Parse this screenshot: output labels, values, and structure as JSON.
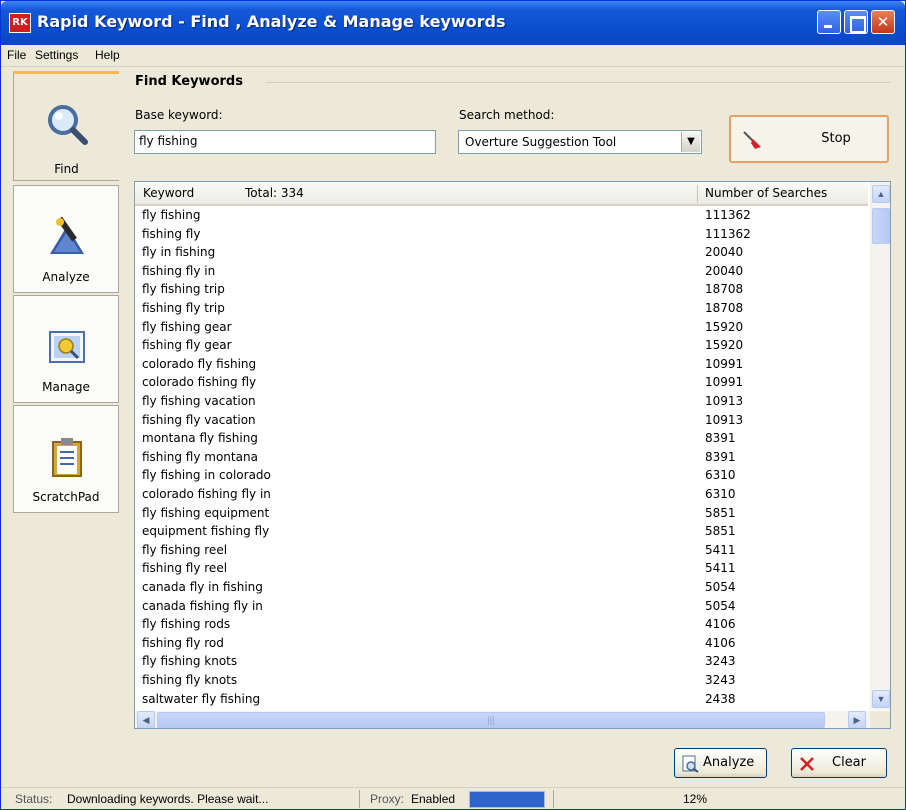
{
  "window": {
    "title": "Rapid Keyword - Find , Analyze & Manage keywords",
    "app_icon_text": "RK"
  },
  "menu": {
    "file": "File",
    "settings": "Settings",
    "help": "Help"
  },
  "nav": {
    "items": [
      {
        "label": "Find",
        "icon": "magnifier-icon",
        "active": true
      },
      {
        "label": "Analyze",
        "icon": "analyze-icon",
        "active": false
      },
      {
        "label": "Manage",
        "icon": "manage-icon",
        "active": false
      },
      {
        "label": "ScratchPad",
        "icon": "clipboard-icon",
        "active": false
      }
    ]
  },
  "find": {
    "group_title": "Find Keywords",
    "base_keyword_label": "Base keyword:",
    "base_keyword_value": "fly fishing",
    "search_method_label": "Search method:",
    "search_method_value": "Overture Suggestion Tool",
    "stop_label": "Stop"
  },
  "table": {
    "col_keyword": "Keyword",
    "total_label": "Total: 334",
    "col_searches": "Number of Searches",
    "rows": [
      {
        "keyword": "fly fishing",
        "searches": "111362"
      },
      {
        "keyword": "fishing fly",
        "searches": "111362"
      },
      {
        "keyword": "fly in fishing",
        "searches": "20040"
      },
      {
        "keyword": "fishing fly in",
        "searches": "20040"
      },
      {
        "keyword": "fly fishing trip",
        "searches": "18708"
      },
      {
        "keyword": "fishing fly trip",
        "searches": "18708"
      },
      {
        "keyword": "fly fishing gear",
        "searches": "15920"
      },
      {
        "keyword": "fishing fly gear",
        "searches": "15920"
      },
      {
        "keyword": "colorado fly fishing",
        "searches": "10991"
      },
      {
        "keyword": "colorado fishing fly",
        "searches": "10991"
      },
      {
        "keyword": "fly fishing vacation",
        "searches": "10913"
      },
      {
        "keyword": "fishing fly vacation",
        "searches": "10913"
      },
      {
        "keyword": "montana fly fishing",
        "searches": "8391"
      },
      {
        "keyword": "fishing fly montana",
        "searches": "8391"
      },
      {
        "keyword": "fly fishing in colorado",
        "searches": "6310"
      },
      {
        "keyword": "colorado fishing fly in",
        "searches": "6310"
      },
      {
        "keyword": "fly fishing equipment",
        "searches": "5851"
      },
      {
        "keyword": "equipment fishing fly",
        "searches": "5851"
      },
      {
        "keyword": "fly fishing reel",
        "searches": "5411"
      },
      {
        "keyword": "fishing fly reel",
        "searches": "5411"
      },
      {
        "keyword": "canada fly in fishing",
        "searches": "5054"
      },
      {
        "keyword": "canada fishing fly in",
        "searches": "5054"
      },
      {
        "keyword": "fly fishing rods",
        "searches": "4106"
      },
      {
        "keyword": "fishing fly rod",
        "searches": "4106"
      },
      {
        "keyword": "fly fishing knots",
        "searches": "3243"
      },
      {
        "keyword": "fishing fly knots",
        "searches": "3243"
      },
      {
        "keyword": "saltwater fly fishing",
        "searches": "2438"
      }
    ]
  },
  "buttons": {
    "analyze": "Analyze",
    "clear": "Clear"
  },
  "status": {
    "status_label": "Status:",
    "status_text": "Downloading keywords. Please wait...",
    "proxy_label": "Proxy:",
    "proxy_value": "Enabled",
    "progress_text": "12%",
    "progress_fraction": 0.12
  }
}
